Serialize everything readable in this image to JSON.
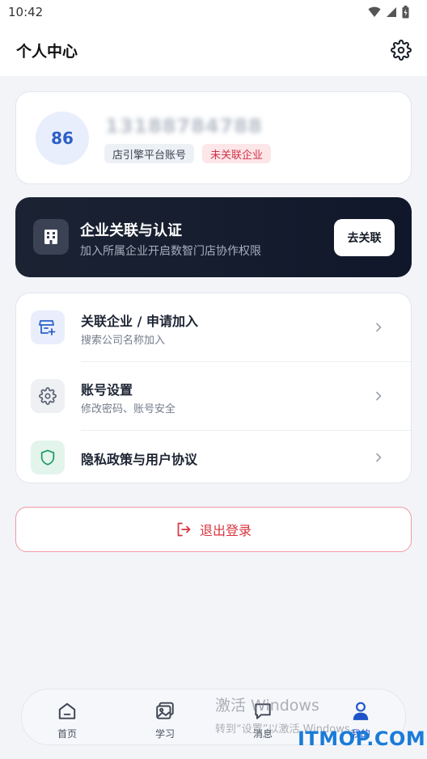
{
  "status_bar": {
    "time": "10:42"
  },
  "header": {
    "title": "个人中心"
  },
  "profile": {
    "avatar_text": "86",
    "phone_masked": "13188784788",
    "tag_account": "店引擎平台账号",
    "tag_status": "未关联企业"
  },
  "banner": {
    "title": "企业关联与认证",
    "subtitle": "加入所属企业开启数智门店协作权限",
    "button": "去关联"
  },
  "menu": {
    "items": [
      {
        "title": "关联企业 / 申请加入",
        "subtitle": "搜索公司名称加入",
        "icon": "store-add-icon"
      },
      {
        "title": "账号设置",
        "subtitle": "修改密码、账号安全",
        "icon": "gear-icon"
      },
      {
        "title": "隐私政策与用户协议",
        "subtitle": "",
        "icon": "shield-icon"
      }
    ]
  },
  "logout": {
    "label": "退出登录"
  },
  "tabbar": {
    "tabs": [
      {
        "label": "首页",
        "icon": "home-icon"
      },
      {
        "label": "学习",
        "icon": "image-icon"
      },
      {
        "label": "消息",
        "icon": "message-icon"
      },
      {
        "label": "我的",
        "icon": "user-icon",
        "active": true
      }
    ]
  },
  "watermark": {
    "windows_title": "激活 Windows",
    "windows_sub": "转到“设置”以激活 Windows。",
    "site": "ITMOP.COM"
  },
  "colors": {
    "accent_blue": "#1e54c8",
    "danger_red": "#d8353f",
    "banner_dark": "#141b2b",
    "page_bg": "#f2f4f8"
  }
}
